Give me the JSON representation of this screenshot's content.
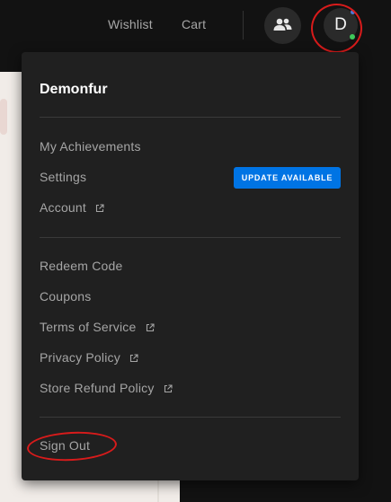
{
  "nav": {
    "wishlist": "Wishlist",
    "cart": "Cart",
    "friends_icon": "friends-icon",
    "avatar_initial": "D",
    "online_status_color": "#3ec85b"
  },
  "dropdown": {
    "username": "Demonfur",
    "section1": [
      {
        "label": "My Achievements",
        "external": false
      },
      {
        "label": "Settings",
        "external": false
      },
      {
        "label": "Account",
        "external": true
      }
    ],
    "update_badge": "UPDATE AVAILABLE",
    "section2": [
      {
        "label": "Redeem Code",
        "external": false
      },
      {
        "label": "Coupons",
        "external": false
      },
      {
        "label": "Terms of Service",
        "external": true
      },
      {
        "label": "Privacy Policy",
        "external": true
      },
      {
        "label": "Store Refund Policy",
        "external": true
      }
    ],
    "sign_out": "Sign Out"
  },
  "colors": {
    "accent": "#0074e4",
    "annotation": "#d81b1b",
    "background": "#121212",
    "panel": "#202020"
  }
}
